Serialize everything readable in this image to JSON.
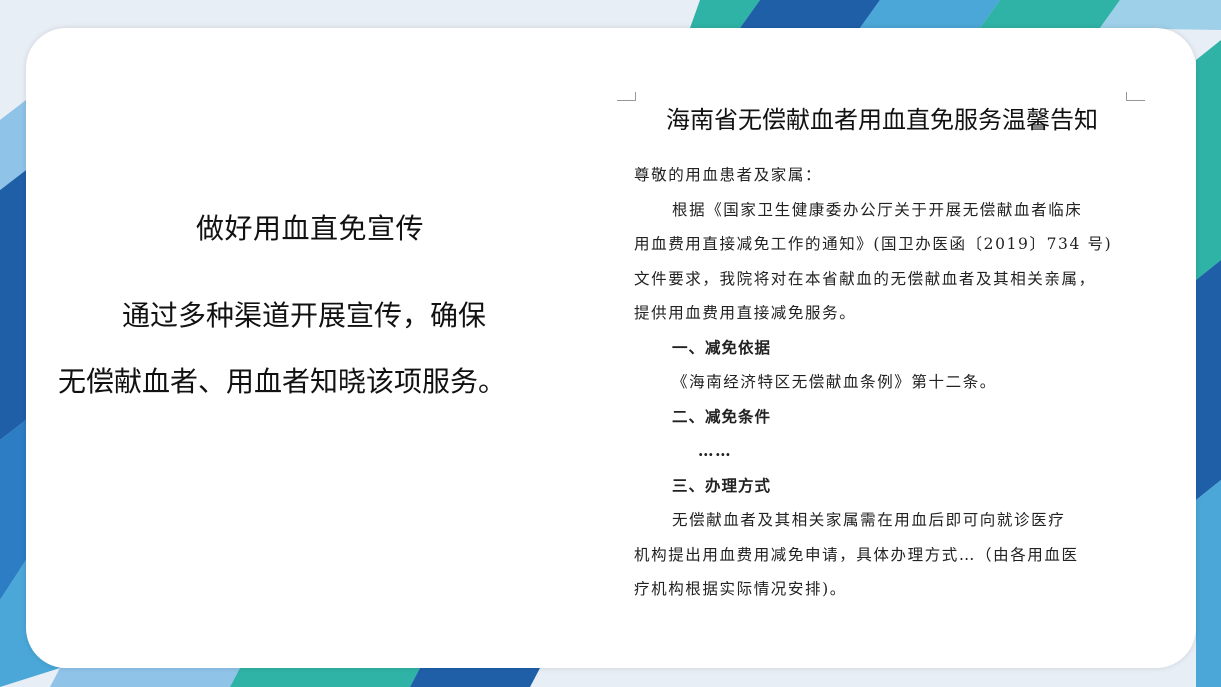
{
  "left": {
    "title": "做好用血直免宣传",
    "line1": "通过多种渠道开展宣传，确保",
    "line2": "无偿献血者、用血者知晓该项服务。"
  },
  "doc": {
    "title": "海南省无偿献血者用血直免服务温馨告知",
    "salutation": "尊敬的用血患者及家属：",
    "para1": [
      "根据《国家卫生健康委办公厅关于开展无偿献血者临床",
      "用血费用直接减免工作的通知》(国卫办医函〔2019〕734 号)",
      "文件要求，我院将对在本省献血的无偿献血者及其相关亲属，",
      "提供用血费用直接减免服务。"
    ],
    "h1": "一、减免依据",
    "basis": "《海南经济特区无偿献血条例》第十二条。",
    "h2": "二、减免条件",
    "ellipsis": "……",
    "h3": "三、办理方式",
    "para3": [
      "无偿献血者及其相关家属需在用血后即可向就诊医疗",
      "机构提出用血费用减免申请，具体办理方式…（由各用血医",
      "疗机构根据实际情况安排)。"
    ]
  },
  "colors": {
    "dark_blue": "#1f5fa8",
    "teal": "#2fb3a6",
    "light_blue": "#8fc3e8"
  }
}
